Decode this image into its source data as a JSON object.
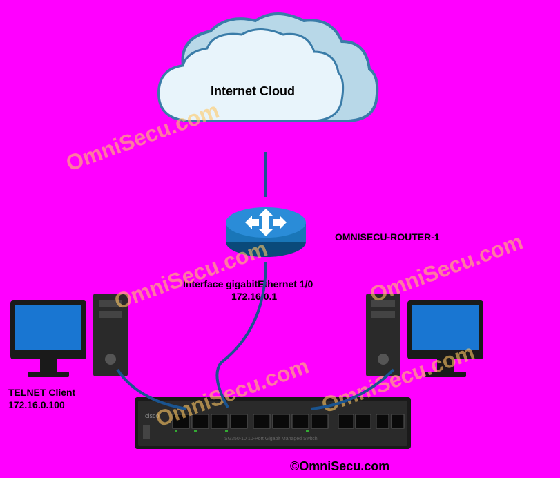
{
  "cloud": {
    "label": "Internet Cloud"
  },
  "router": {
    "name": "OMNISECU-ROUTER-1",
    "interface_label": "Interface gigabitEthernet 1/0",
    "interface_ip": "172.16.0.1"
  },
  "telnet_client": {
    "label": "TELNET Client",
    "ip": "172.16.0.100"
  },
  "copyright": "©OmniSecu.com",
  "watermark": "OmniSecu.com"
}
